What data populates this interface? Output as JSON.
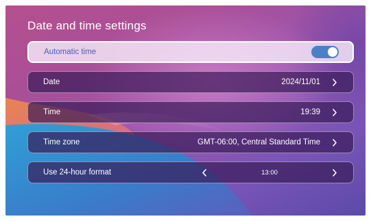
{
  "header": {
    "title": "Date and time settings"
  },
  "rows": {
    "auto_time": {
      "label": "Automatic time",
      "enabled": true
    },
    "date": {
      "label": "Date",
      "value": "2024/11/01"
    },
    "time": {
      "label": "Time",
      "value": "19:39"
    },
    "timezone": {
      "label": "Time zone",
      "value": "GMT-06:00, Central Standard Time"
    },
    "format": {
      "label": "Use 24-hour format",
      "value": "13:00"
    }
  },
  "colors": {
    "toggle_on": "#4d7fc9",
    "auto_label": "#4a60b8",
    "row_bg": "#37195588"
  },
  "icons": [
    "chevron-right-icon",
    "chevron-left-icon"
  ]
}
